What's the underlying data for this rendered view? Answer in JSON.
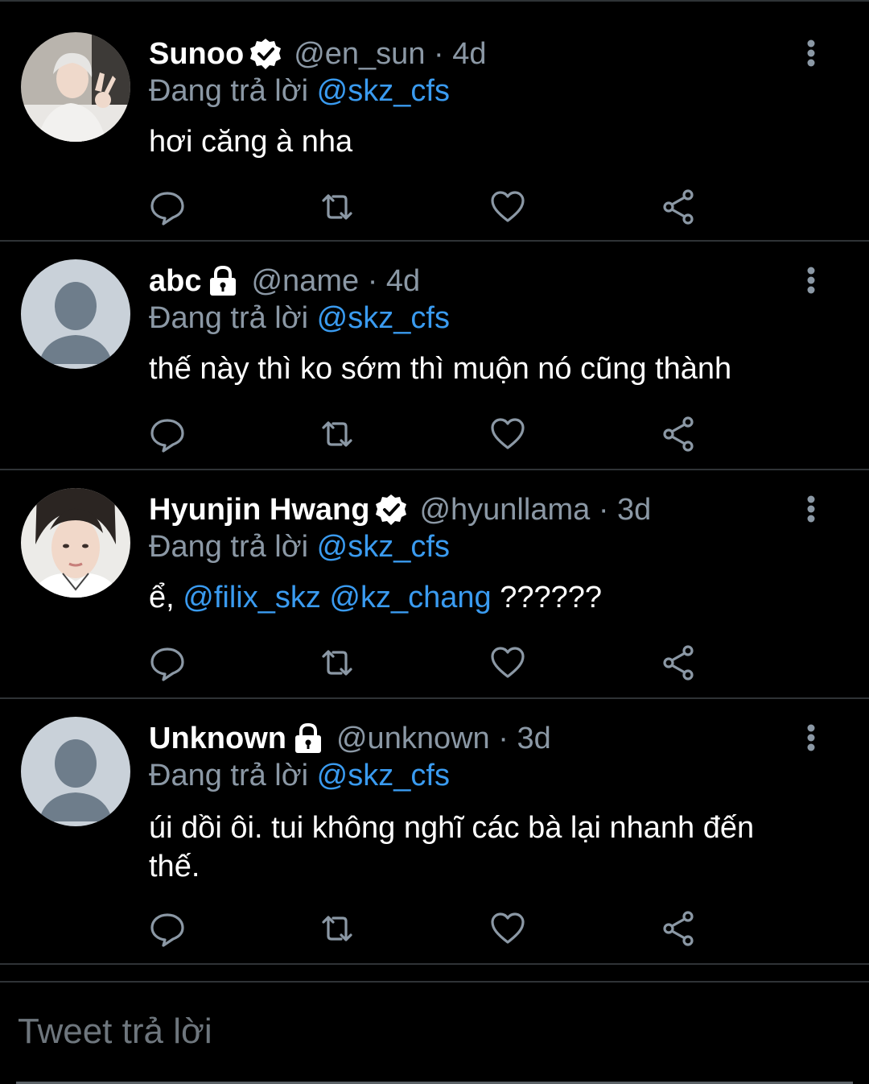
{
  "tweets": [
    {
      "name": "Sunoo",
      "badge": "verified",
      "handle": "@en_sun",
      "time": "· 4d",
      "replying_prefix": "Đang trả lời",
      "replying_to": "@skz_cfs",
      "text": "hơi căng à nha",
      "avatar": "photo-sunoo"
    },
    {
      "name": "abc",
      "badge": "lock",
      "handle": "@name",
      "time": "· 4d",
      "replying_prefix": "Đang trả lời",
      "replying_to": "@skz_cfs",
      "text": "thế này thì ko sớm thì muộn nó cũng thành",
      "avatar": "default-avatar"
    },
    {
      "name": "Hyunjin Hwang",
      "badge": "verified",
      "handle": "@hyunllama",
      "time": "· 3d",
      "replying_prefix": "Đang trả lời",
      "replying_to": "@skz_cfs",
      "text_prefix": "ể,",
      "mention_1": "@filix_skz",
      "mention_2": "@kz_chang",
      "text_suffix": "??????",
      "avatar": "photo-hyunjin"
    },
    {
      "name": "Unknown",
      "badge": "lock",
      "handle": "@unknown",
      "time": "· 3d",
      "replying_prefix": "Đang trả lời",
      "replying_to": "@skz_cfs",
      "text": "úi dồi ôi. tui không nghĩ các bà lại nhanh đến thế.",
      "avatar": "default-avatar"
    }
  ],
  "composer": {
    "placeholder": "Tweet trả lời"
  },
  "icons": {
    "reply": "reply-icon",
    "retweet": "retweet-icon",
    "like": "heart-icon",
    "share": "share-icon",
    "more": "more-vertical-icon"
  },
  "colors": {
    "background": "#000000",
    "text": "#ffffff",
    "muted": "#8b98a5",
    "link": "#3a9bf0",
    "divider": "#2f3336"
  }
}
